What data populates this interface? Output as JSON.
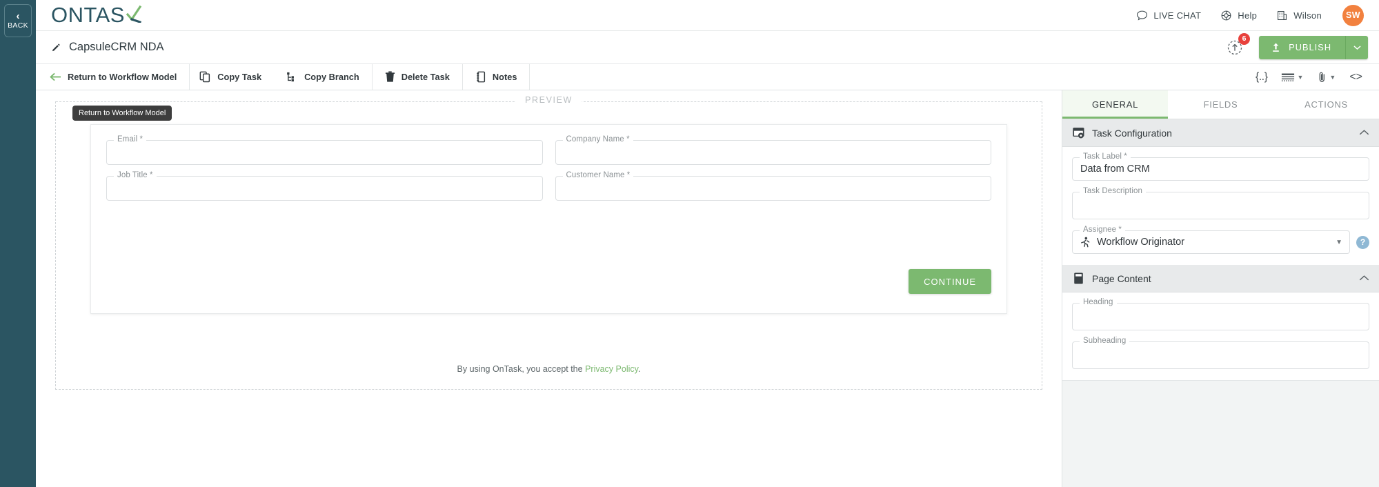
{
  "rail": {
    "back_label": "BACK",
    "back_icon": "chevron-left-icon"
  },
  "header": {
    "logo_text": "ONTAS",
    "logo_mark": "k-check-mark",
    "actions": [
      {
        "label": "LIVE CHAT",
        "icon": "chat-bubble-icon"
      },
      {
        "label": "Help",
        "icon": "lifebuoy-icon"
      },
      {
        "label": "Wilson",
        "icon": "building-icon"
      }
    ],
    "avatar_initials": "SW",
    "avatar_color": "#f2813f"
  },
  "title_row": {
    "pencil_icon": "pencil-icon",
    "title": "CapsuleCRM NDA",
    "notification_icon": "upload-circle-icon",
    "notification_count": "6",
    "publish_label": "PUBLISH",
    "publish_icon": "upload-icon",
    "publish_caret_icon": "chevron-down-icon",
    "publish_color": "#7cb970"
  },
  "toolbar": {
    "items": [
      {
        "label": "Return to Workflow Model",
        "icon": "arrow-left-icon"
      },
      {
        "label": "Copy Task",
        "icon": "copy-icon"
      },
      {
        "label": "Copy Branch",
        "icon": "branch-icon"
      },
      {
        "label": "Delete Task",
        "icon": "trash-icon"
      },
      {
        "label": "Notes",
        "icon": "notebook-icon"
      }
    ],
    "right_icons": [
      {
        "name": "json-braces-icon",
        "glyph": "{..}",
        "caret": false
      },
      {
        "name": "layout-rows-icon",
        "glyph": "rows",
        "caret": true
      },
      {
        "name": "paperclip-icon",
        "glyph": "clip",
        "caret": true
      },
      {
        "name": "code-brackets-icon",
        "glyph": "<>",
        "caret": false
      }
    ]
  },
  "tooltip": {
    "text": "Return to Workflow Model"
  },
  "preview": {
    "legend": "PREVIEW",
    "fields_left": [
      {
        "label": "Email *",
        "value": ""
      },
      {
        "label": "Job Title *",
        "value": ""
      }
    ],
    "fields_right": [
      {
        "label": "Company Name *",
        "value": ""
      },
      {
        "label": "Customer Name *",
        "value": ""
      }
    ],
    "continue_label": "CONTINUE",
    "legal_prefix": "By using OnTask, you accept the ",
    "legal_link": "Privacy Policy",
    "legal_suffix": "."
  },
  "right_panel": {
    "tabs": [
      {
        "label": "GENERAL",
        "active": true
      },
      {
        "label": "FIELDS",
        "active": false
      },
      {
        "label": "ACTIONS",
        "active": false
      }
    ],
    "sections": [
      {
        "title": "Task Configuration",
        "icon": "window-gear-icon",
        "chevron": "chevron-up-icon",
        "fields": [
          {
            "label": "Task Label *",
            "value": "Data from CRM"
          },
          {
            "label": "Task Description",
            "value": ""
          },
          {
            "label": "Assignee *",
            "value": "Workflow Originator",
            "icon": "runner-icon",
            "help": "?"
          }
        ]
      },
      {
        "title": "Page Content",
        "icon": "page-icon",
        "chevron": "chevron-up-icon",
        "fields": [
          {
            "label": "Heading",
            "value": ""
          },
          {
            "label": "Subheading",
            "value": ""
          }
        ]
      }
    ]
  }
}
